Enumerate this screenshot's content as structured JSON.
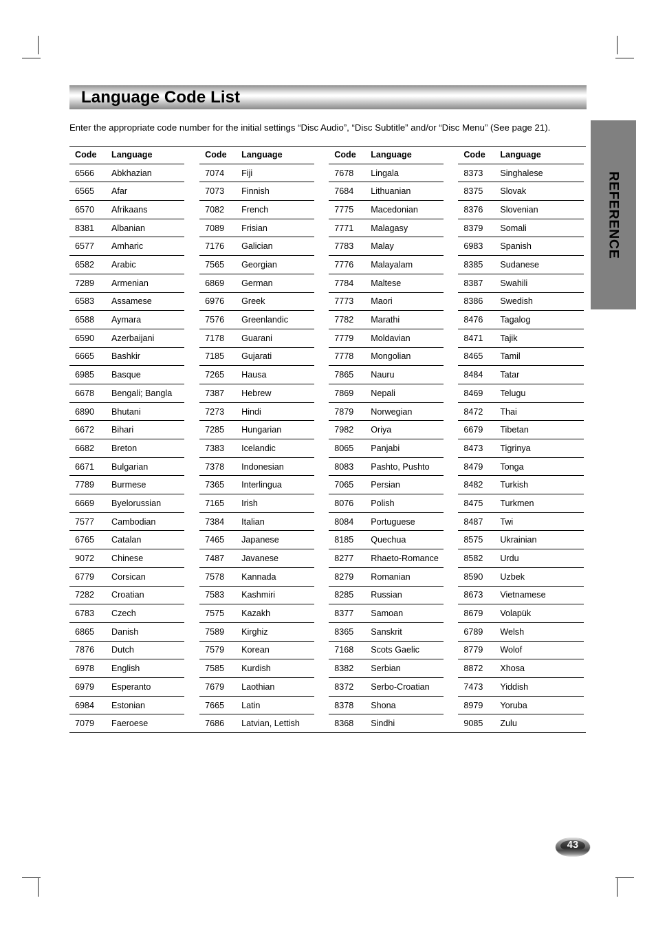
{
  "page": {
    "title": "Language Code List",
    "intro": "Enter the appropriate code number for the initial settings “Disc Audio”, “Disc Subtitle” and/or “Disc Menu” (See page 21).",
    "side_tab_label": "REFERENCE",
    "page_number": "43",
    "colors": {
      "side_tab_background": "#808080",
      "rule": "#000000",
      "text": "#000000",
      "page_background": "#ffffff"
    }
  },
  "table": {
    "headers": {
      "code": "Code",
      "language": "Language"
    },
    "columns": [
      {
        "rows": [
          {
            "code": "6566",
            "language": "Abkhazian"
          },
          {
            "code": "6565",
            "language": "Afar"
          },
          {
            "code": "6570",
            "language": "Afrikaans"
          },
          {
            "code": "8381",
            "language": "Albanian"
          },
          {
            "code": "6577",
            "language": "Amharic"
          },
          {
            "code": "6582",
            "language": "Arabic"
          },
          {
            "code": "7289",
            "language": "Armenian"
          },
          {
            "code": "6583",
            "language": "Assamese"
          },
          {
            "code": "6588",
            "language": "Aymara"
          },
          {
            "code": "6590",
            "language": "Azerbaijani"
          },
          {
            "code": "6665",
            "language": "Bashkir"
          },
          {
            "code": "6985",
            "language": "Basque"
          },
          {
            "code": "6678",
            "language": "Bengali; Bangla"
          },
          {
            "code": "6890",
            "language": "Bhutani"
          },
          {
            "code": "6672",
            "language": "Bihari"
          },
          {
            "code": "6682",
            "language": "Breton"
          },
          {
            "code": "6671",
            "language": "Bulgarian"
          },
          {
            "code": "7789",
            "language": "Burmese"
          },
          {
            "code": "6669",
            "language": "Byelorussian"
          },
          {
            "code": "7577",
            "language": "Cambodian"
          },
          {
            "code": "6765",
            "language": "Catalan"
          },
          {
            "code": "9072",
            "language": "Chinese"
          },
          {
            "code": "6779",
            "language": "Corsican"
          },
          {
            "code": "7282",
            "language": "Croatian"
          },
          {
            "code": "6783",
            "language": "Czech"
          },
          {
            "code": "6865",
            "language": "Danish"
          },
          {
            "code": "7876",
            "language": "Dutch"
          },
          {
            "code": "6978",
            "language": "English"
          },
          {
            "code": "6979",
            "language": "Esperanto"
          },
          {
            "code": "6984",
            "language": "Estonian"
          },
          {
            "code": "7079",
            "language": "Faeroese"
          }
        ]
      },
      {
        "rows": [
          {
            "code": "7074",
            "language": "Fiji"
          },
          {
            "code": "7073",
            "language": "Finnish"
          },
          {
            "code": "7082",
            "language": "French"
          },
          {
            "code": "7089",
            "language": "Frisian"
          },
          {
            "code": "7176",
            "language": "Galician"
          },
          {
            "code": "7565",
            "language": "Georgian"
          },
          {
            "code": "6869",
            "language": "German"
          },
          {
            "code": "6976",
            "language": "Greek"
          },
          {
            "code": "7576",
            "language": "Greenlandic"
          },
          {
            "code": "7178",
            "language": "Guarani"
          },
          {
            "code": "7185",
            "language": "Gujarati"
          },
          {
            "code": "7265",
            "language": "Hausa"
          },
          {
            "code": "7387",
            "language": "Hebrew"
          },
          {
            "code": "7273",
            "language": "Hindi"
          },
          {
            "code": "7285",
            "language": "Hungarian"
          },
          {
            "code": "7383",
            "language": "Icelandic"
          },
          {
            "code": "7378",
            "language": "Indonesian"
          },
          {
            "code": "7365",
            "language": "Interlingua"
          },
          {
            "code": "7165",
            "language": "Irish"
          },
          {
            "code": "7384",
            "language": "Italian"
          },
          {
            "code": "7465",
            "language": "Japanese"
          },
          {
            "code": "7487",
            "language": "Javanese"
          },
          {
            "code": "7578",
            "language": "Kannada"
          },
          {
            "code": "7583",
            "language": "Kashmiri"
          },
          {
            "code": "7575",
            "language": "Kazakh"
          },
          {
            "code": "7589",
            "language": "Kirghiz"
          },
          {
            "code": "7579",
            "language": "Korean"
          },
          {
            "code": "7585",
            "language": "Kurdish"
          },
          {
            "code": "7679",
            "language": "Laothian"
          },
          {
            "code": "7665",
            "language": "Latin"
          },
          {
            "code": "7686",
            "language": "Latvian, Lettish"
          }
        ]
      },
      {
        "rows": [
          {
            "code": "7678",
            "language": "Lingala"
          },
          {
            "code": "7684",
            "language": "Lithuanian"
          },
          {
            "code": "7775",
            "language": "Macedonian"
          },
          {
            "code": "7771",
            "language": "Malagasy"
          },
          {
            "code": "7783",
            "language": "Malay"
          },
          {
            "code": "7776",
            "language": "Malayalam"
          },
          {
            "code": "7784",
            "language": "Maltese"
          },
          {
            "code": "7773",
            "language": "Maori"
          },
          {
            "code": "7782",
            "language": "Marathi"
          },
          {
            "code": "7779",
            "language": "Moldavian"
          },
          {
            "code": "7778",
            "language": "Mongolian"
          },
          {
            "code": "7865",
            "language": "Nauru"
          },
          {
            "code": "7869",
            "language": "Nepali"
          },
          {
            "code": "7879",
            "language": "Norwegian"
          },
          {
            "code": "7982",
            "language": "Oriya"
          },
          {
            "code": "8065",
            "language": "Panjabi"
          },
          {
            "code": "8083",
            "language": "Pashto, Pushto"
          },
          {
            "code": "7065",
            "language": "Persian"
          },
          {
            "code": "8076",
            "language": "Polish"
          },
          {
            "code": "8084",
            "language": "Portuguese"
          },
          {
            "code": "8185",
            "language": "Quechua"
          },
          {
            "code": "8277",
            "language": "Rhaeto-Romance"
          },
          {
            "code": "8279",
            "language": "Romanian"
          },
          {
            "code": "8285",
            "language": "Russian"
          },
          {
            "code": "8377",
            "language": "Samoan"
          },
          {
            "code": "8365",
            "language": "Sanskrit"
          },
          {
            "code": "7168",
            "language": "Scots Gaelic"
          },
          {
            "code": "8382",
            "language": "Serbian"
          },
          {
            "code": "8372",
            "language": "Serbo-Croatian"
          },
          {
            "code": "8378",
            "language": "Shona"
          },
          {
            "code": "8368",
            "language": "Sindhi"
          }
        ]
      },
      {
        "rows": [
          {
            "code": "8373",
            "language": "Singhalese"
          },
          {
            "code": "8375",
            "language": "Slovak"
          },
          {
            "code": "8376",
            "language": "Slovenian"
          },
          {
            "code": "8379",
            "language": "Somali"
          },
          {
            "code": "6983",
            "language": "Spanish"
          },
          {
            "code": "8385",
            "language": "Sudanese"
          },
          {
            "code": "8387",
            "language": "Swahili"
          },
          {
            "code": "8386",
            "language": "Swedish"
          },
          {
            "code": "8476",
            "language": "Tagalog"
          },
          {
            "code": "8471",
            "language": "Tajik"
          },
          {
            "code": "8465",
            "language": "Tamil"
          },
          {
            "code": "8484",
            "language": "Tatar"
          },
          {
            "code": "8469",
            "language": "Telugu"
          },
          {
            "code": "8472",
            "language": "Thai"
          },
          {
            "code": "6679",
            "language": "Tibetan"
          },
          {
            "code": "8473",
            "language": "Tigrinya"
          },
          {
            "code": "8479",
            "language": "Tonga"
          },
          {
            "code": "8482",
            "language": "Turkish"
          },
          {
            "code": "8475",
            "language": "Turkmen"
          },
          {
            "code": "8487",
            "language": "Twi"
          },
          {
            "code": "8575",
            "language": "Ukrainian"
          },
          {
            "code": "8582",
            "language": "Urdu"
          },
          {
            "code": "8590",
            "language": "Uzbek"
          },
          {
            "code": "8673",
            "language": "Vietnamese"
          },
          {
            "code": "8679",
            "language": "Volapük"
          },
          {
            "code": "6789",
            "language": "Welsh"
          },
          {
            "code": "8779",
            "language": "Wolof"
          },
          {
            "code": "8872",
            "language": "Xhosa"
          },
          {
            "code": "7473",
            "language": "Yiddish"
          },
          {
            "code": "8979",
            "language": "Yoruba"
          },
          {
            "code": "9085",
            "language": "Zulu"
          }
        ]
      }
    ]
  }
}
